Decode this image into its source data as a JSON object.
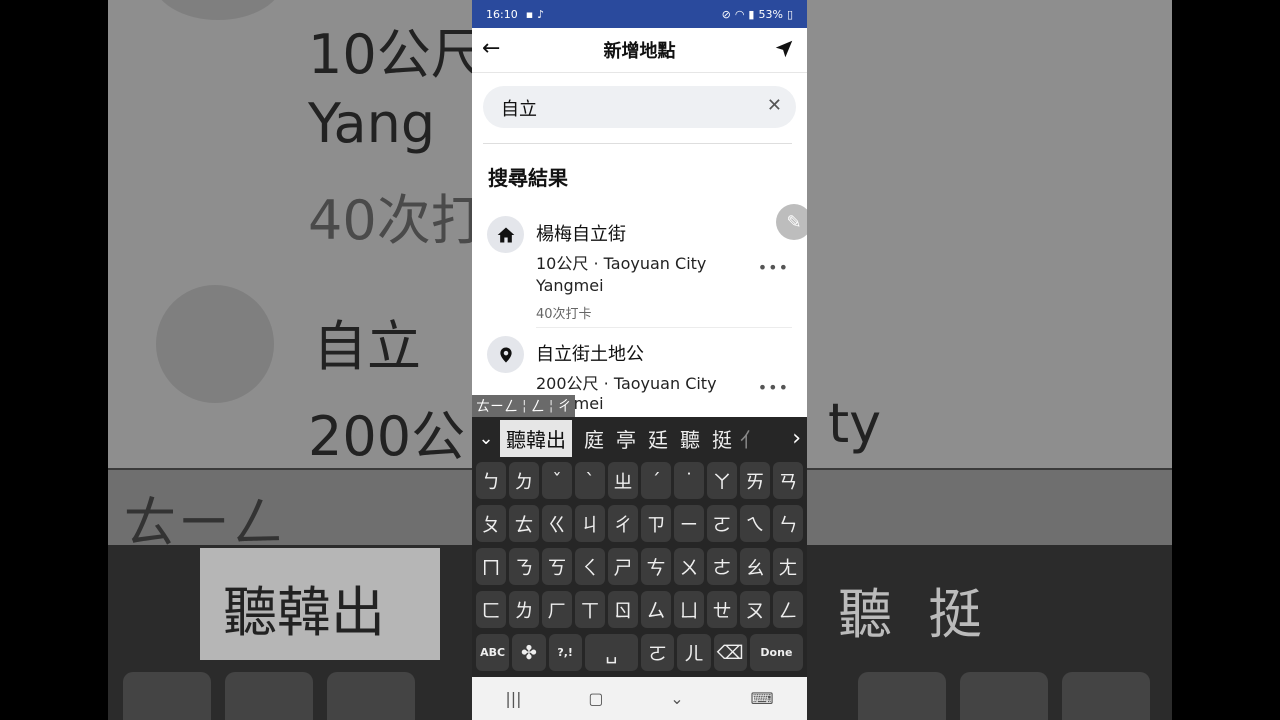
{
  "status_bar": {
    "time": "16:10",
    "battery": "53%"
  },
  "app_bar": {
    "title": "新增地點"
  },
  "search": {
    "value": "自立"
  },
  "section_title": "搜尋結果",
  "results": [
    {
      "name": "楊梅自立街",
      "distance": "10公尺",
      "sep": "·",
      "location": "Taoyuan City",
      "district": "Yangmei",
      "checkins": "40次打卡",
      "icon": "house-icon"
    },
    {
      "name": "自立街土地公",
      "distance": "200公尺",
      "sep": "·",
      "location": "Taoyuan City",
      "district": "Yangmei",
      "icon": "location-pin-icon"
    }
  ],
  "composition": {
    "part1": "ㄊㄧㄥ",
    "part2": "ㄥ",
    "part3": "ㄔ"
  },
  "candidates": {
    "selected": "聽韓出",
    "items": [
      "庭",
      "亭",
      "廷",
      "聽",
      "挺"
    ],
    "overflow": "亻"
  },
  "keyboard": {
    "rows": [
      [
        "ㄅ",
        "ㄉ",
        "ˇ",
        "ˋ",
        "ㄓ",
        "ˊ",
        "˙",
        "ㄚ",
        "ㄞ",
        "ㄢ"
      ],
      [
        "ㄆ",
        "ㄊ",
        "ㄍ",
        "ㄐ",
        "ㄔ",
        "ㄗ",
        "ㄧ",
        "ㄛ",
        "ㄟ",
        "ㄣ"
      ],
      [
        "ㄇ",
        "ㄋ",
        "ㄎ",
        "ㄑ",
        "ㄕ",
        "ㄘ",
        "ㄨ",
        "ㄜ",
        "ㄠ",
        "ㄤ"
      ],
      [
        "ㄈ",
        "ㄌ",
        "ㄏ",
        "ㄒ",
        "ㄖ",
        "ㄙ",
        "ㄩ",
        "ㄝ",
        "ㄡ",
        "ㄥ"
      ]
    ],
    "abc_label": "ABC",
    "punct_label": "?,!",
    "space_label": "␣",
    "circle_label": "ㄛ",
    "er_label": "ㄦ",
    "done_label": "Done"
  },
  "background": {
    "line1": "10公尺",
    "line2": "Yang",
    "line3": "40次打",
    "line4": "自立",
    "line5": "200公",
    "line6": "ㄊㄧㄥ",
    "line7": "聽韓出",
    "line8": "聽",
    "line9": "挺",
    "line10": "ty"
  }
}
